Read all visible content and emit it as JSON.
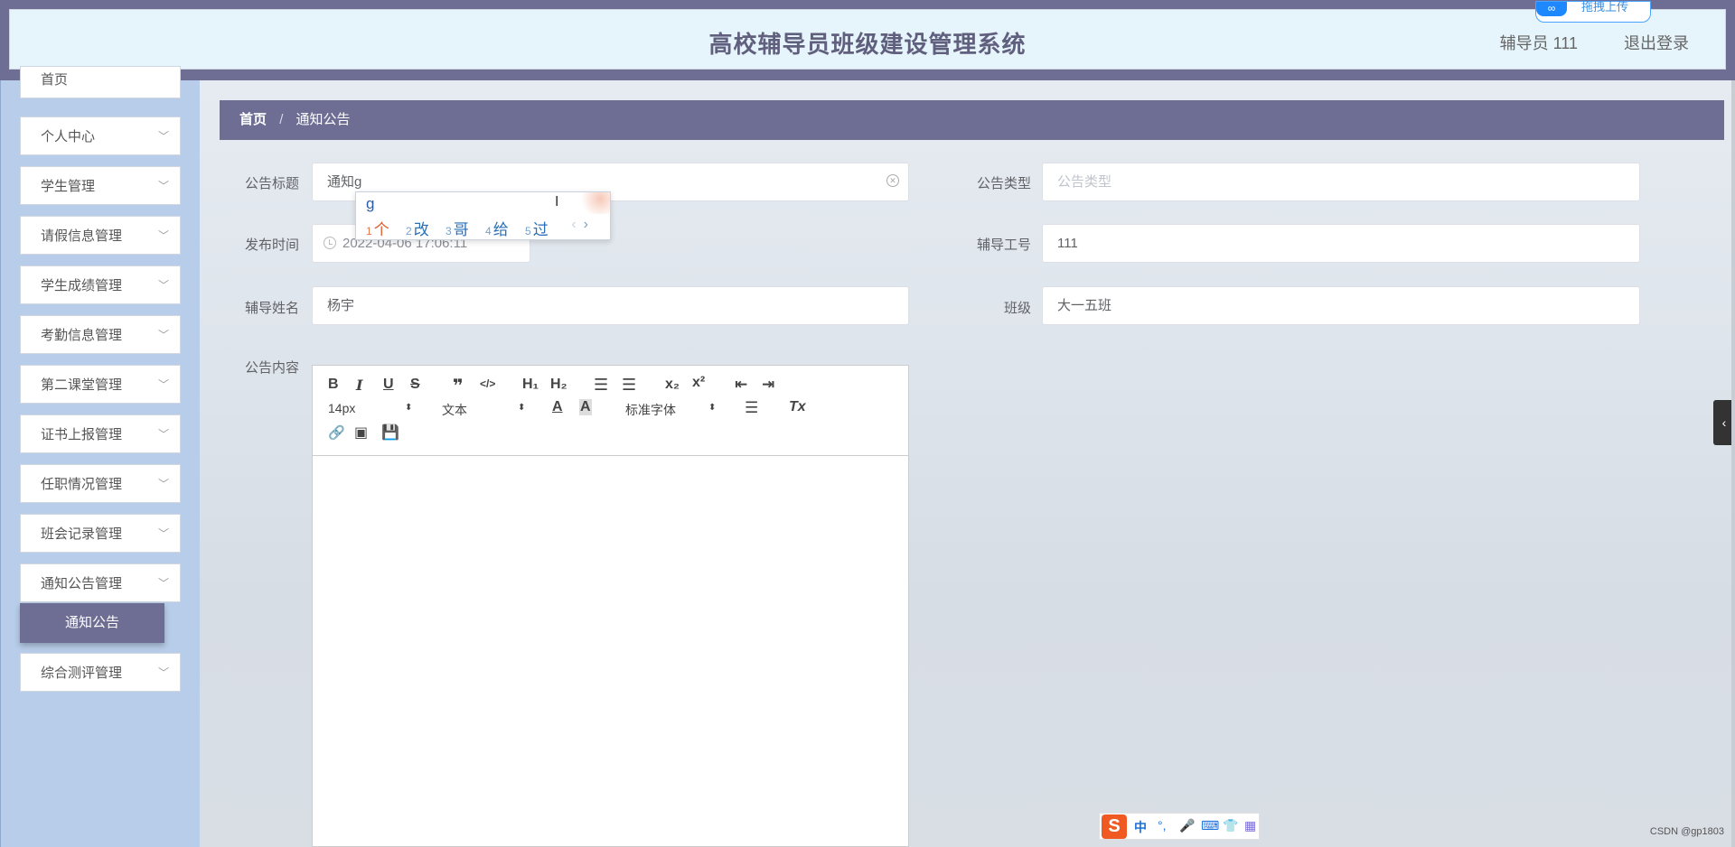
{
  "header": {
    "title": "高校辅导员班级建设管理系统",
    "user": "辅导员 111",
    "logout": "退出登录",
    "upload_chip": "拖拽上传"
  },
  "sidebar": {
    "items": [
      {
        "label": "首页"
      },
      {
        "label": "个人中心"
      },
      {
        "label": "学生管理"
      },
      {
        "label": "请假信息管理"
      },
      {
        "label": "学生成绩管理"
      },
      {
        "label": "考勤信息管理"
      },
      {
        "label": "第二课堂管理"
      },
      {
        "label": "证书上报管理"
      },
      {
        "label": "任职情况管理"
      },
      {
        "label": "班会记录管理"
      },
      {
        "label": "通知公告管理"
      },
      {
        "label": "综合测评管理"
      }
    ],
    "active_sub": "通知公告"
  },
  "breadcrumb": {
    "home": "首页",
    "sep": "/",
    "current": "通知公告"
  },
  "form": {
    "title_label": "公告标题",
    "title_value": "通知g",
    "type_label": "公告类型",
    "type_placeholder": "公告类型",
    "publish_label": "发布时间",
    "publish_value": "2022-04-06 17:06:11",
    "counselor_id_label": "辅导工号",
    "counselor_id_value": "111",
    "counselor_name_label": "辅导姓名",
    "counselor_name_value": "杨宇",
    "class_label": "班级",
    "class_value": "大一五班",
    "content_label": "公告内容"
  },
  "editor": {
    "font_size": "14px",
    "block_type": "文本",
    "font_family": "标准字体"
  },
  "ime": {
    "input": "g",
    "candidates": [
      {
        "num": "1",
        "text": "个"
      },
      {
        "num": "2",
        "text": "改"
      },
      {
        "num": "3",
        "text": "哥"
      },
      {
        "num": "4",
        "text": "给"
      },
      {
        "num": "5",
        "text": "过"
      }
    ],
    "prev": "‹",
    "next": "›"
  },
  "ime_bar": {
    "mode": "中",
    "punct": "°,"
  },
  "right_handle": "‹",
  "watermark": "CSDN @gp1803"
}
